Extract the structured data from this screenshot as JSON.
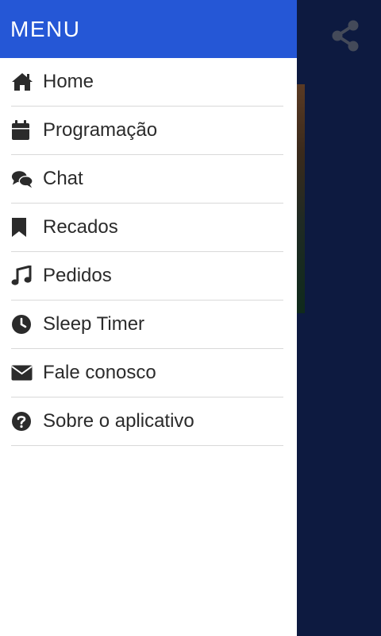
{
  "drawer": {
    "title": "MENU",
    "items": [
      {
        "label": "Home",
        "icon": "home-icon"
      },
      {
        "label": "Programação",
        "icon": "calendar-icon"
      },
      {
        "label": "Chat",
        "icon": "chat-icon"
      },
      {
        "label": "Recados",
        "icon": "bookmark-icon"
      },
      {
        "label": "Pedidos",
        "icon": "music-icon"
      },
      {
        "label": "Sleep Timer",
        "icon": "clock-icon"
      },
      {
        "label": "Fale conosco",
        "icon": "envelope-icon"
      },
      {
        "label": "Sobre o aplicativo",
        "icon": "help-icon"
      }
    ]
  },
  "colors": {
    "header_bg": "#2557d6",
    "app_bg": "#0d1a40",
    "icon": "#2b2b2b",
    "text": "#2b2b2b"
  },
  "app": {
    "share_icon": "share-icon"
  }
}
